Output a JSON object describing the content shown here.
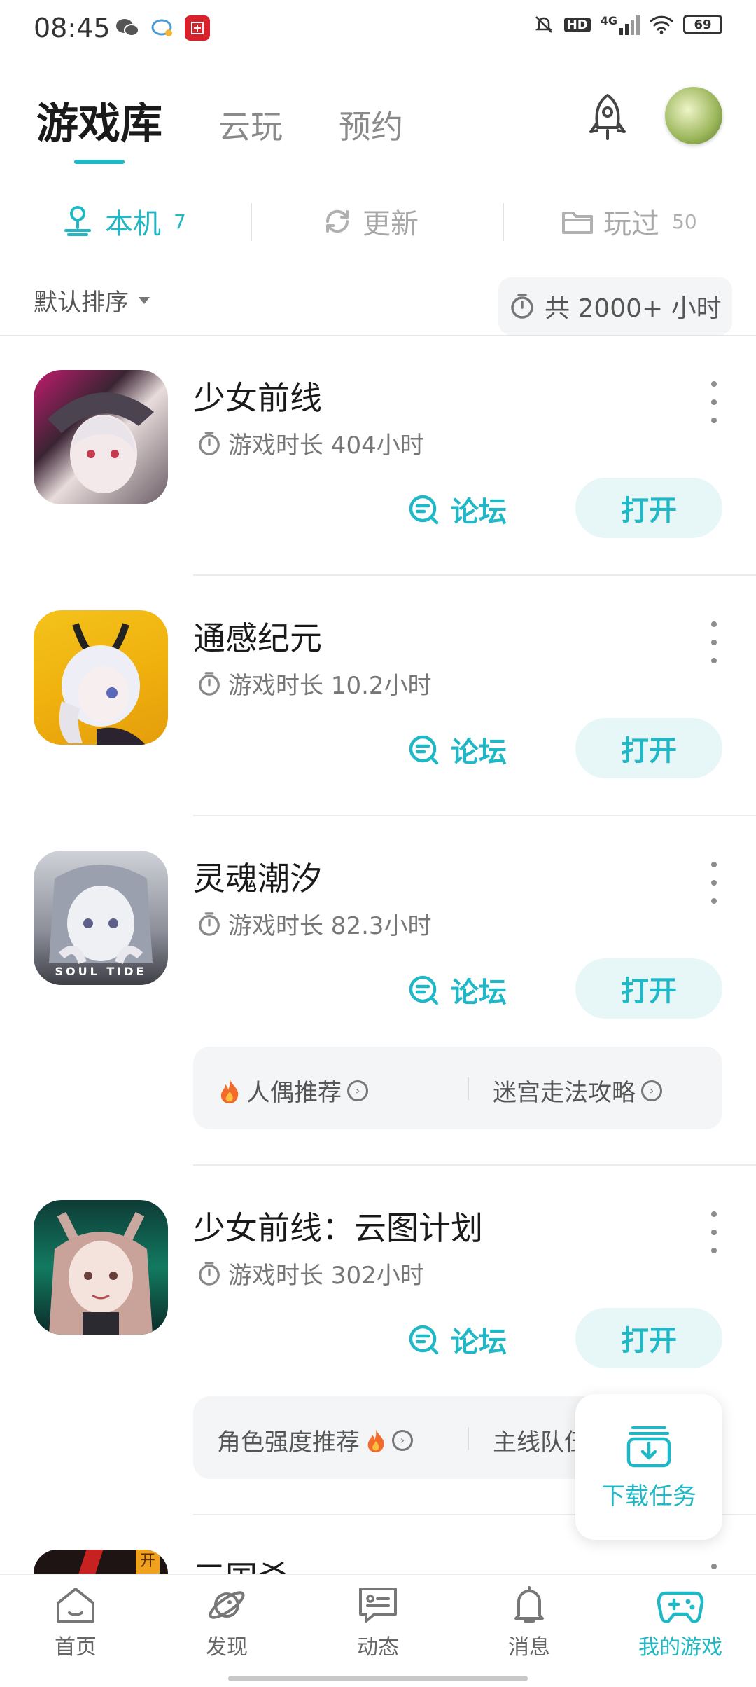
{
  "status": {
    "time": "08:45",
    "network": "4G",
    "battery": "69"
  },
  "top_tabs": [
    {
      "label": "游戏库"
    },
    {
      "label": "云玩"
    },
    {
      "label": "预约"
    }
  ],
  "sub_tabs": [
    {
      "label": "本机",
      "count": "7"
    },
    {
      "label": "更新",
      "count": ""
    },
    {
      "label": "玩过",
      "count": "50"
    }
  ],
  "sort": {
    "label": "默认排序"
  },
  "total": {
    "label": "共 2000+ 小时"
  },
  "games": [
    {
      "name": "少女前线",
      "playtime": "游戏时长 404小时",
      "forum": "论坛",
      "open": "打开"
    },
    {
      "name": "通感纪元",
      "playtime": "游戏时长 10.2小时",
      "forum": "论坛",
      "open": "打开"
    },
    {
      "name": "灵魂潮汐",
      "playtime": "游戏时长 82.3小时",
      "forum": "论坛",
      "open": "打开",
      "icon_text": "SOUL TIDE"
    },
    {
      "name": "少女前线：云图计划",
      "playtime": "游戏时长 302小时",
      "forum": "论坛",
      "open": "打开"
    },
    {
      "name": "三国杀",
      "icon_badge": "开"
    }
  ],
  "guides": {
    "soul_tide": [
      "人偶推荐",
      "迷宫走法攻略"
    ],
    "cloud": [
      "角色强度推荐",
      "主线队伍"
    ]
  },
  "download": {
    "label": "下载任务"
  },
  "bottom_nav": [
    {
      "label": "首页",
      "icon": "home-icon"
    },
    {
      "label": "发现",
      "icon": "planet-icon"
    },
    {
      "label": "动态",
      "icon": "chat-icon"
    },
    {
      "label": "消息",
      "icon": "bell-icon"
    },
    {
      "label": "我的游戏",
      "icon": "gamepad-icon"
    }
  ],
  "colors": {
    "accent": "#20b8c6"
  }
}
